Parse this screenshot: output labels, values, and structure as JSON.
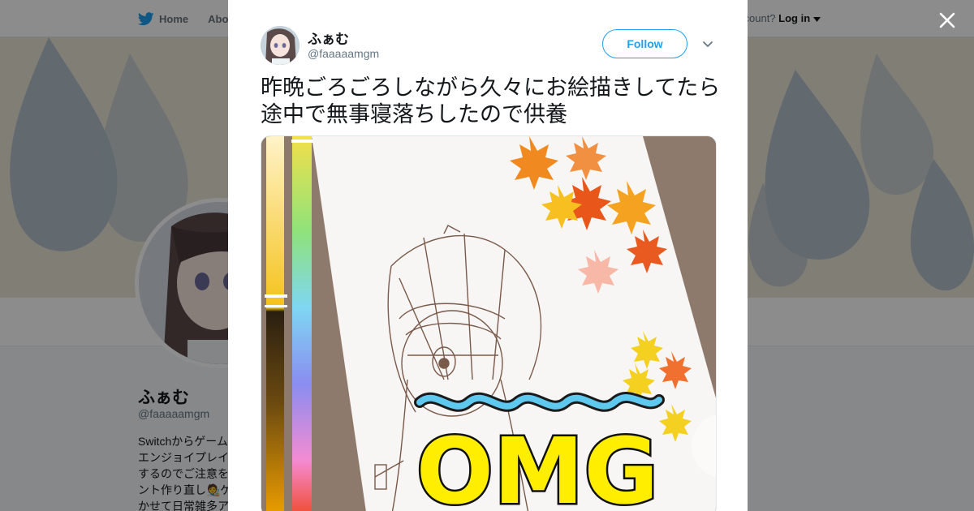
{
  "nav": {
    "home_label": "Home",
    "about_label": "Abo",
    "account_prompt": "ccount?",
    "login_label": "Log in"
  },
  "profile": {
    "name": "ふぁむ",
    "handle": "@faaaaamgm",
    "bio_lines": [
      "Switchからゲーム",
      "エンジョイプレイ",
      "するのでご注意を",
      "ント作り直し🧑‍🎨ゲ",
      "かせて日常雑多ア"
    ]
  },
  "tweet": {
    "author_name": "ふぁむ",
    "author_handle": "@faaaaamgm",
    "follow_label": "Follow",
    "text": "昨晩ごろごろしながら久々にお絵描きしてたら途中で無事寝落ちしたので供養",
    "media": {
      "overlay_text": "OMG"
    }
  },
  "colors": {
    "twitter_blue": "#1da1f2",
    "text_primary": "#14171a",
    "text_secondary": "#657786",
    "overlay_text_fill": "#ffee00"
  },
  "icons": {
    "home": "twitter-bird-icon",
    "close": "close-icon",
    "chevron": "chevron-down-icon",
    "caret": "caret-down-icon"
  }
}
